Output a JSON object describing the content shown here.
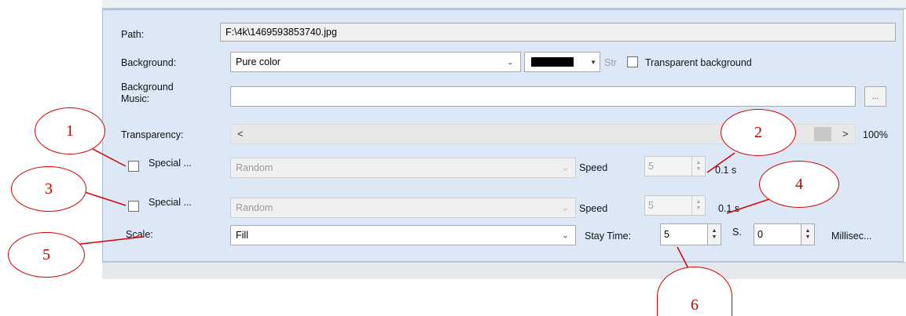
{
  "form": {
    "path_label": "Path:",
    "path_value": "F:\\4k\\1469593853740.jpg",
    "background_label": "Background:",
    "background_value": "Pure color",
    "color_value": "#000000",
    "str_label": "Str",
    "transparent_label": "Transparent background",
    "bg_music_label_1": "Background",
    "bg_music_label_2": "Music:",
    "browse_label": "...",
    "transparency_label": "Transparency:",
    "scroll_left": "<",
    "scroll_right": ">",
    "transparency_value": "100%",
    "special1_label": "Special ...",
    "special1_effect": "Random",
    "speed1_label": "Speed",
    "speed1_value": "5",
    "speed1_unit": "0.1 s",
    "special2_label": "Special ...",
    "special2_effect": "Random",
    "speed2_label": "Speed",
    "speed2_value": "5",
    "speed2_unit": "0.1 s",
    "scale_label": "Scale:",
    "scale_value": "Fill",
    "stay_time_label": "Stay Time:",
    "stay_time_value": "5",
    "seconds_label": "S.",
    "millisec_value": "0",
    "millisec_label": "Millisec..."
  },
  "callouts": {
    "c1": "1",
    "c2": "2",
    "c3": "3",
    "c4": "4",
    "c5": "5",
    "c6": "6"
  },
  "colors": {
    "panel_bg": "#dce8f6",
    "callout_red": "#d00000"
  }
}
